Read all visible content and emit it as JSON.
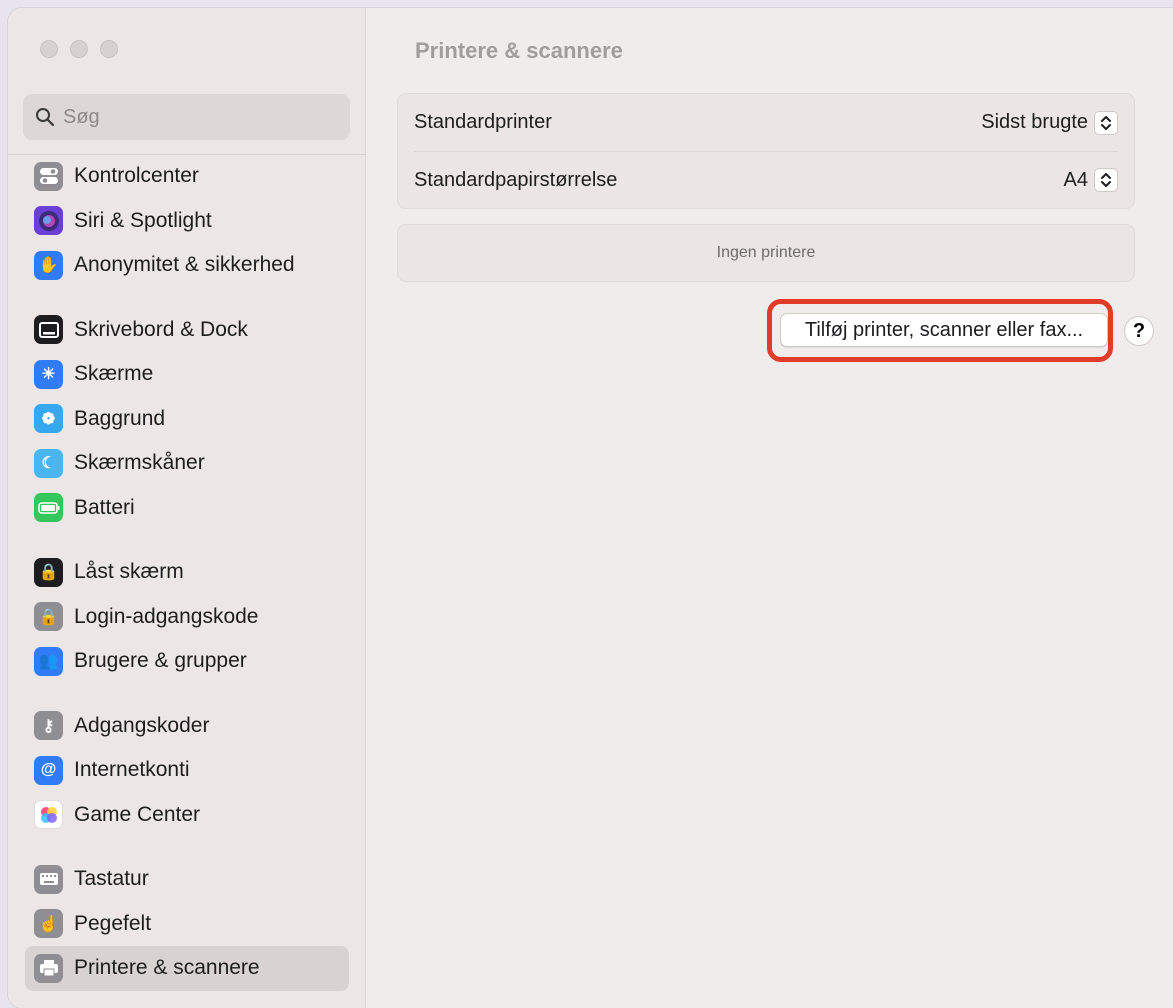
{
  "window": {
    "title": "Printere & scannere"
  },
  "search": {
    "placeholder": "Søg"
  },
  "sidebar": {
    "groups": [
      [
        {
          "label": "Kontrolcenter",
          "icon": "control-center-icon",
          "color": "#8e8e93"
        },
        {
          "label": "Siri & Spotlight",
          "icon": "siri-icon",
          "color": "#6a3fd6"
        },
        {
          "label": "Anonymitet & sikkerhed",
          "icon": "hand-icon",
          "color": "#2f7cf6"
        }
      ],
      [
        {
          "label": "Skrivebord & Dock",
          "icon": "dock-icon",
          "color": "#1d1d1f"
        },
        {
          "label": "Skærme",
          "icon": "brightness-icon",
          "color": "#2f7cf6"
        },
        {
          "label": "Baggrund",
          "icon": "flower-icon",
          "color": "#36a8f0"
        },
        {
          "label": "Skærmskåner",
          "icon": "screensaver-icon",
          "color": "#4ab6f0"
        },
        {
          "label": "Batteri",
          "icon": "battery-icon",
          "color": "#34c759"
        }
      ],
      [
        {
          "label": "Låst skærm",
          "icon": "lock-screen-icon",
          "color": "#1d1d1f"
        },
        {
          "label": "Login-adgangskode",
          "icon": "lock-icon",
          "color": "#8e8e93"
        },
        {
          "label": "Brugere & grupper",
          "icon": "users-icon",
          "color": "#2f7cf6"
        }
      ],
      [
        {
          "label": "Adgangskoder",
          "icon": "key-icon",
          "color": "#8e8e93"
        },
        {
          "label": "Internetkonti",
          "icon": "at-icon",
          "color": "#2f7cf6"
        },
        {
          "label": "Game Center",
          "icon": "game-center-icon",
          "color": "#ffffff"
        }
      ],
      [
        {
          "label": "Tastatur",
          "icon": "keyboard-icon",
          "color": "#8e8e93"
        },
        {
          "label": "Pegefelt",
          "icon": "trackpad-icon",
          "color": "#8e8e93"
        },
        {
          "label": "Printere & scannere",
          "icon": "printer-icon",
          "color": "#8e8e93",
          "active": true
        }
      ]
    ]
  },
  "main": {
    "title": "Printere & scannere",
    "settings": [
      {
        "label": "Standardprinter",
        "value": "Sidst brugte"
      },
      {
        "label": "Standardpapirstørrelse",
        "value": "A4"
      }
    ],
    "printers_empty": "Ingen printere",
    "add_button": "Tilføj printer, scanner eller fax...",
    "help_button": "?"
  }
}
